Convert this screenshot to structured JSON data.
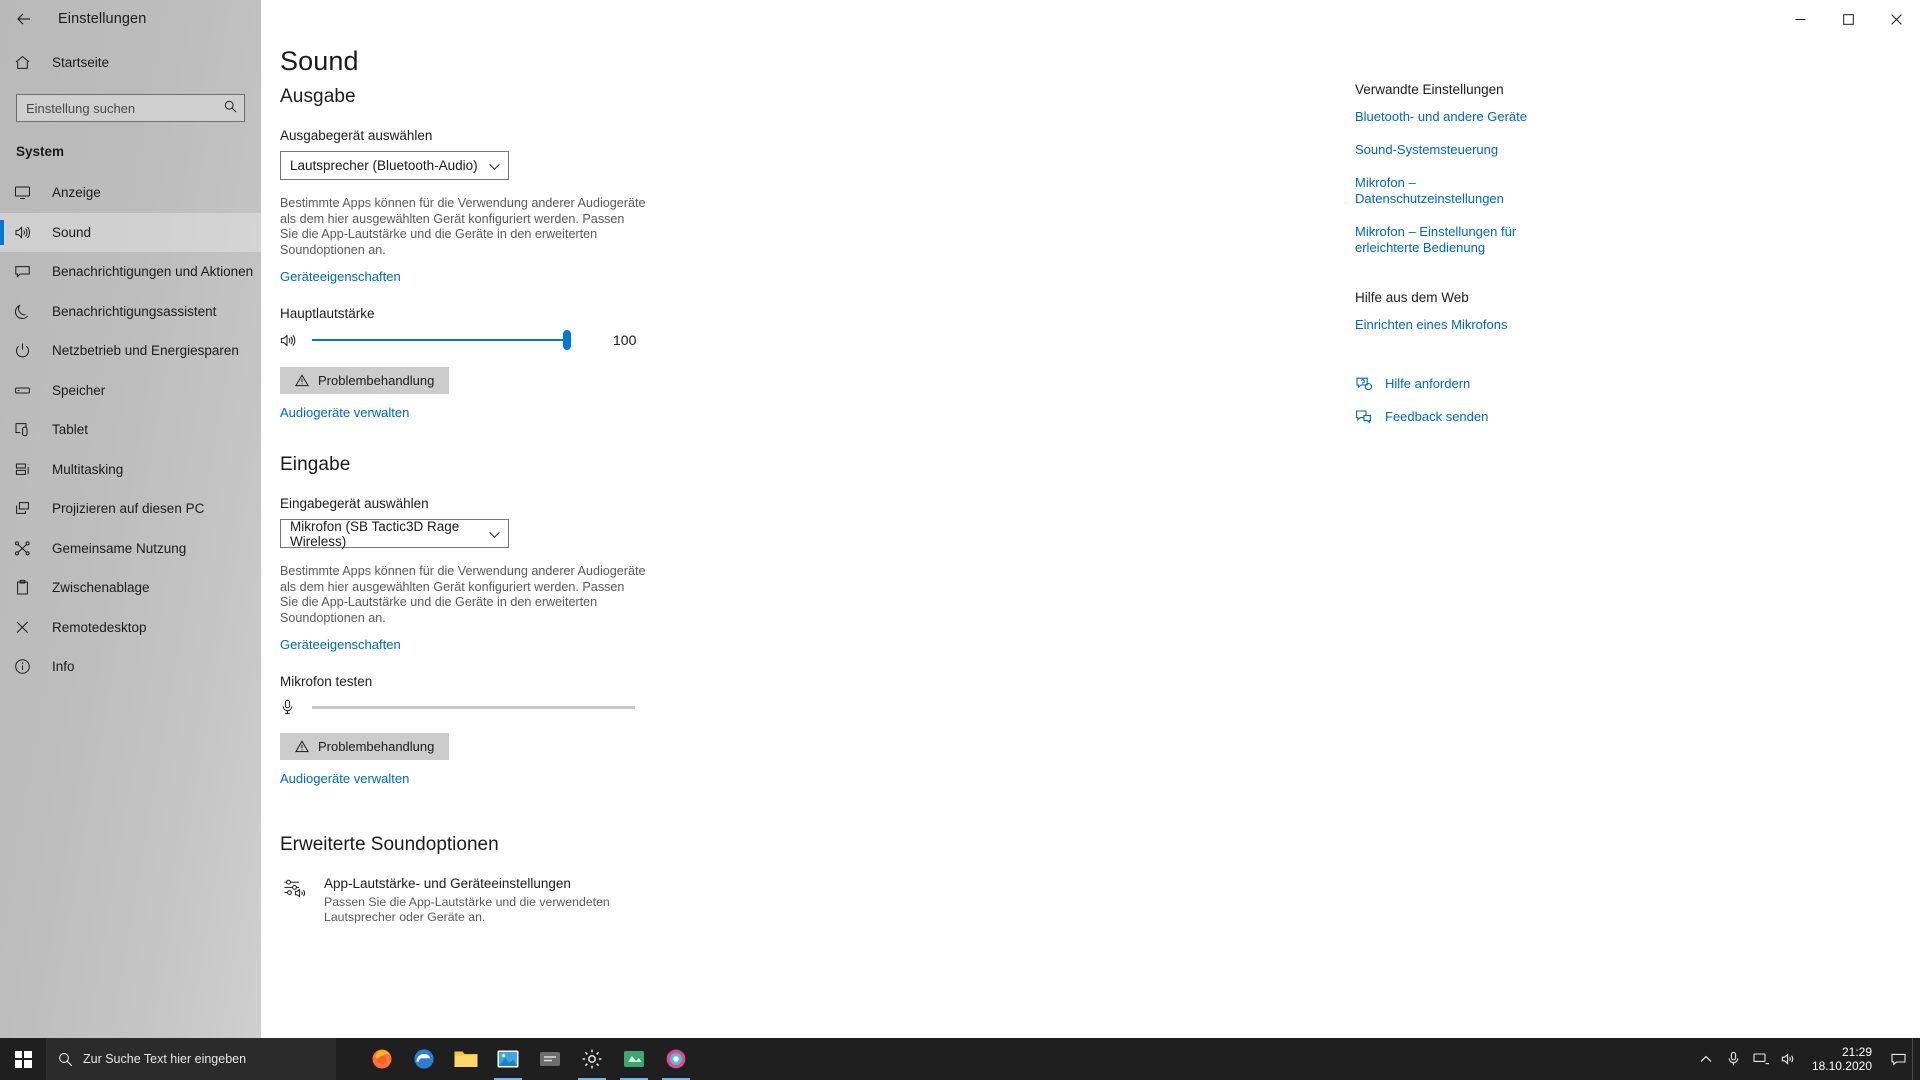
{
  "window": {
    "title": "Einstellungen",
    "back_icon": "back-arrow-icon",
    "minimize_label": "Minimieren",
    "maximize_label": "Maximieren",
    "close_label": "Schließen"
  },
  "sidebar": {
    "home": {
      "label": "Startseite",
      "icon": "home-icon"
    },
    "search": {
      "placeholder": "Einstellung suchen",
      "value": "",
      "icon": "search-icon"
    },
    "section": "System",
    "items": [
      {
        "label": "Anzeige",
        "icon": "monitor-icon",
        "selected": false
      },
      {
        "label": "Sound",
        "icon": "speaker-icon",
        "selected": true
      },
      {
        "label": "Benachrichtigungen und Aktionen",
        "icon": "notification-icon",
        "selected": false
      },
      {
        "label": "Benachrichtigungsassistent",
        "icon": "moon-icon",
        "selected": false
      },
      {
        "label": "Netzbetrieb und Energiesparen",
        "icon": "power-icon",
        "selected": false
      },
      {
        "label": "Speicher",
        "icon": "storage-icon",
        "selected": false
      },
      {
        "label": "Tablet",
        "icon": "tablet-icon",
        "selected": false
      },
      {
        "label": "Multitasking",
        "icon": "multitasking-icon",
        "selected": false
      },
      {
        "label": "Projizieren auf diesen PC",
        "icon": "project-icon",
        "selected": false
      },
      {
        "label": "Gemeinsame Nutzung",
        "icon": "share-icon",
        "selected": false
      },
      {
        "label": "Zwischenablage",
        "icon": "clipboard-icon",
        "selected": false
      },
      {
        "label": "Remotedesktop",
        "icon": "remote-desktop-icon",
        "selected": false
      },
      {
        "label": "Info",
        "icon": "info-icon",
        "selected": false
      }
    ]
  },
  "page": {
    "title": "Sound",
    "output": {
      "heading": "Ausgabe",
      "device_label": "Ausgabegerät auswählen",
      "device_value": "Lautsprecher (Bluetooth-Audio)",
      "description": "Bestimmte Apps können für die Verwendung anderer Audiogeräte als dem hier ausgewählten Gerät konfiguriert werden. Passen Sie die App-Lautstärke und die Geräte in den erweiterten Soundoptionen an.",
      "properties_link": "Geräteeigenschaften",
      "volume_label": "Hauptlautstärke",
      "volume_value": "100",
      "volume_percent": 100,
      "troubleshoot_button": "Problembehandlung",
      "manage_link": "Audiogeräte verwalten"
    },
    "input": {
      "heading": "Eingabe",
      "device_label": "Eingabegerät auswählen",
      "device_value": "Mikrofon (SB Tactic3D Rage Wireless)",
      "description": "Bestimmte Apps können für die Verwendung anderer Audiogeräte als dem hier ausgewählten Gerät konfiguriert werden. Passen Sie die App-Lautstärke und die Geräte in den erweiterten Soundoptionen an.",
      "properties_link": "Geräteeigenschaften",
      "test_label": "Mikrofon testen",
      "test_level_percent": 0,
      "troubleshoot_button": "Problembehandlung",
      "manage_link": "Audiogeräte verwalten"
    },
    "advanced": {
      "heading": "Erweiterte Soundoptionen",
      "item_title": "App-Lautstärke- und Geräteeinstellungen",
      "item_sub": "Passen Sie die App-Lautstärke und die verwendeten Lautsprecher oder Geräte an.",
      "item_icon": "mixer-icon"
    }
  },
  "right_rail": {
    "related_heading": "Verwandte Einstellungen",
    "related_links": [
      "Bluetooth- und andere Geräte",
      "Sound-Systemsteuerung",
      "Mikrofon – Datenschutzeinstellungen",
      "Mikrofon – Einstellungen für erleichterte Bedienung"
    ],
    "web_help_heading": "Hilfe aus dem Web",
    "web_help_links": [
      "Einrichten eines Mikrofons"
    ],
    "support": [
      {
        "label": "Hilfe anfordern",
        "icon": "help-icon"
      },
      {
        "label": "Feedback senden",
        "icon": "feedback-icon"
      }
    ]
  },
  "taskbar": {
    "start_label": "Start",
    "search_placeholder": "Zur Suche Text hier eingeben",
    "search_icon": "search-icon",
    "apps": [
      {
        "name": "firefox-taskbar-icon",
        "active": false
      },
      {
        "name": "edge-taskbar-icon",
        "active": false
      },
      {
        "name": "file-explorer-taskbar-icon",
        "active": false
      },
      {
        "name": "photos-taskbar-icon",
        "active": true
      },
      {
        "name": "tool-taskbar-icon",
        "active": false
      },
      {
        "name": "settings-taskbar-icon",
        "active": true
      },
      {
        "name": "app-taskbar-icon",
        "active": true
      },
      {
        "name": "browser-taskbar-icon",
        "active": true
      }
    ],
    "tray": [
      {
        "name": "show-hidden-icons-icon"
      },
      {
        "name": "microphone-tray-icon"
      },
      {
        "name": "network-tray-icon"
      },
      {
        "name": "volume-tray-icon"
      }
    ],
    "clock_time": "21:29",
    "clock_date": "18.10.2020",
    "action_center_icon": "action-center-icon"
  },
  "colors": {
    "accent": "#0078d7",
    "link": "#0067c0",
    "sidebar": "#bdbdbd",
    "taskbar": "#1f1f1f"
  }
}
